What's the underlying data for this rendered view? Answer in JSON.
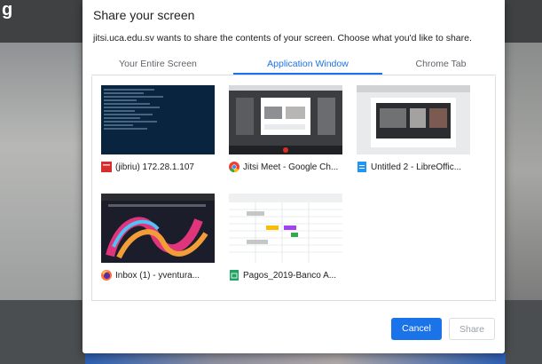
{
  "background": {
    "logo_text": "g"
  },
  "dialog": {
    "title": "Share your screen",
    "description": "jitsi.uca.edu.sv wants to share the contents of your screen. Choose what you'd like to share.",
    "tabs": [
      {
        "label": "Your Entire Screen",
        "active": false
      },
      {
        "label": "Application Window",
        "active": true
      },
      {
        "label": "Chrome Tab",
        "active": false
      }
    ],
    "windows": [
      {
        "label": "(jibriu) 172.28.1.107",
        "icon": "terminal-icon"
      },
      {
        "label": "Jitsi Meet - Google Ch...",
        "icon": "chrome-icon"
      },
      {
        "label": "Untitled 2 - LibreOffic...",
        "icon": "libreoffice-writer-icon"
      },
      {
        "label": "Inbox (1) - yventura...",
        "icon": "firefox-icon"
      },
      {
        "label": "Pagos_2019-Banco A...",
        "icon": "spreadsheet-icon"
      }
    ],
    "buttons": {
      "cancel": "Cancel",
      "share": "Share"
    }
  }
}
